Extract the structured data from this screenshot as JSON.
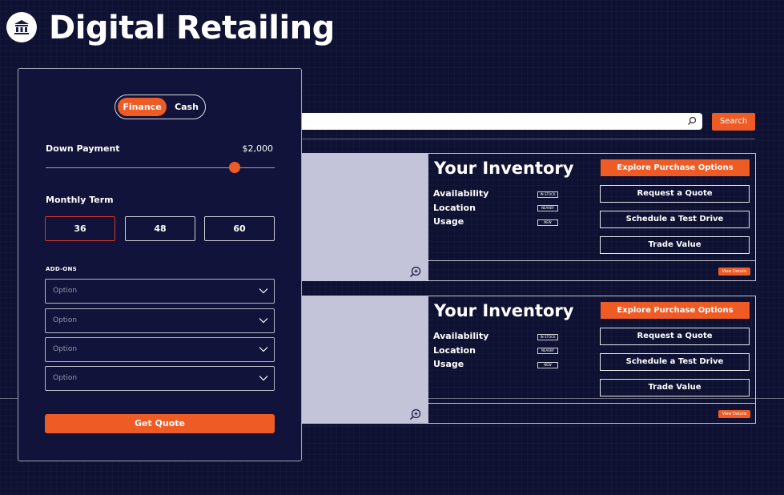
{
  "header": {
    "title": "Digital Retailing",
    "logo_icon": "dealership-icon"
  },
  "search": {
    "placeholder": "",
    "button_label": "Search"
  },
  "inventory_cards": [
    {
      "title": "Your Inventory",
      "specs": [
        {
          "label": "Availability",
          "badge": "IN STOCK"
        },
        {
          "label": "Location",
          "badge": "NEARBY"
        },
        {
          "label": "Usage",
          "badge": "NEW"
        }
      ],
      "actions": {
        "primary": "Explore Purchase Options",
        "quote": "Request a Quote",
        "test_drive": "Schedule a Test Drive",
        "trade": "Trade Value"
      },
      "details_label": "View Details"
    },
    {
      "title": "Your Inventory",
      "specs": [
        {
          "label": "Availability",
          "badge": "IN STOCK"
        },
        {
          "label": "Location",
          "badge": "NEARBY"
        },
        {
          "label": "Usage",
          "badge": "NEW"
        }
      ],
      "actions": {
        "primary": "Explore Purchase Options",
        "quote": "Request a Quote",
        "test_drive": "Schedule a Test Drive",
        "trade": "Trade Value"
      },
      "details_label": "View Details"
    }
  ],
  "panel": {
    "toggle": {
      "finance": "Finance",
      "cash": "Cash",
      "selected": "Finance"
    },
    "down_payment": {
      "label": "Down Payment",
      "value": "$2,000",
      "slider_fraction": 0.83
    },
    "monthly_term": {
      "label": "Monthly Term",
      "options": [
        "36",
        "48",
        "60"
      ],
      "selected": "36"
    },
    "addons": {
      "label": "ADD-ONS",
      "options": [
        "Option",
        "Option",
        "Option",
        "Option"
      ]
    },
    "submit_label": "Get Quote"
  },
  "colors": {
    "background": "#0f1133",
    "accent": "#ef5b25",
    "image_placeholder": "#c3c3d9",
    "selected_border": "#d9372a"
  }
}
